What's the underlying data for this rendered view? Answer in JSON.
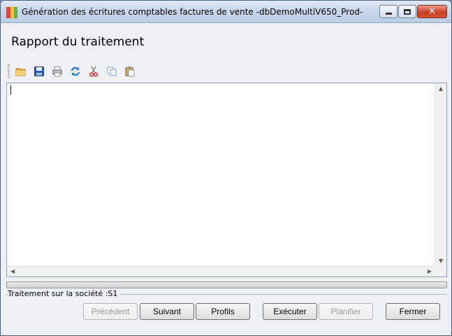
{
  "window": {
    "title": "Génération des écritures comptables factures de vente -dbDemoMultiV650_Prod-"
  },
  "heading": "Rapport du traitement",
  "toolbar": {
    "tools": [
      {
        "name": "open-folder-icon",
        "label": "Ouvrir"
      },
      {
        "name": "save-icon",
        "label": "Enregistrer"
      },
      {
        "name": "print-icon",
        "label": "Imprimer"
      },
      {
        "name": "refresh-icon",
        "label": "Actualiser"
      },
      {
        "name": "cut-icon",
        "label": "Couper"
      },
      {
        "name": "copy-icon",
        "label": "Copier"
      },
      {
        "name": "paste-icon",
        "label": "Coller"
      }
    ]
  },
  "editor": {
    "value": ""
  },
  "progress": {
    "value": 0
  },
  "status": {
    "text": "Traitement sur la société :S1"
  },
  "buttons": {
    "previous": "Précédent",
    "next": "Suivant",
    "profiles": "Profils",
    "execute": "Exécuter",
    "schedule": "Planifier",
    "close": "Fermer"
  },
  "colors": {
    "titlebar": "#c8d6ea",
    "window_bg": "#eef0f5",
    "close_button": "#c9412a",
    "refresh_icon": "#2a7bd0",
    "cut_icon": "#d33a3a",
    "folder_icon": "#e7b44a",
    "save_icon": "#2d5fb8"
  }
}
